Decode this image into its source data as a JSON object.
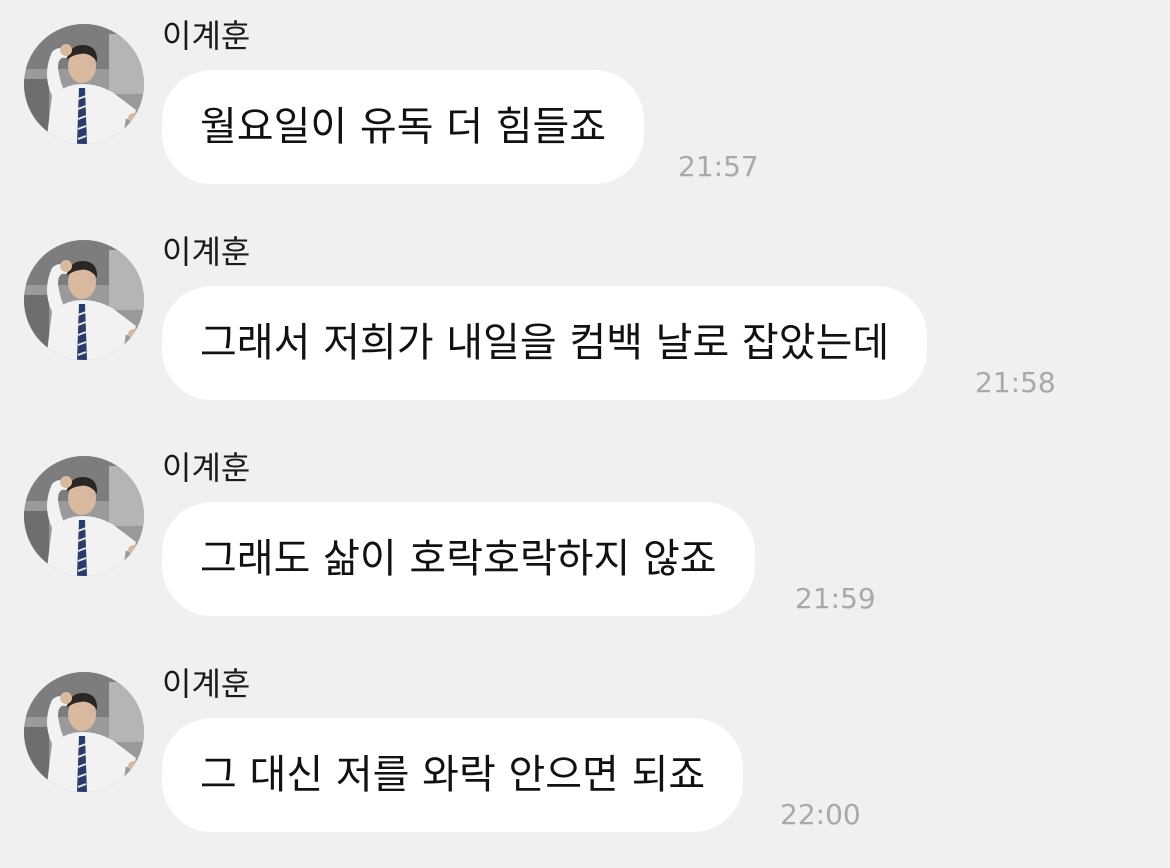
{
  "messages": [
    {
      "sender": "이계훈",
      "text": "월요일이 유독 더 힘들죠",
      "time": "21:57"
    },
    {
      "sender": "이계훈",
      "text": "그래서 저희가 내일을 컴백 날로 잡았는데",
      "time": "21:58"
    },
    {
      "sender": "이계훈",
      "text": "그래도 삶이 호락호락하지 않죠",
      "time": "21:59"
    },
    {
      "sender": "이계훈",
      "text": "그 대신 저를 와락 안으면 되죠",
      "time": "22:00"
    }
  ],
  "avatar_icon": "profile-photo",
  "colors": {
    "background": "#f0f0f0",
    "bubble": "#ffffff",
    "timestamp": "#a9a9a9",
    "text": "#111111"
  }
}
